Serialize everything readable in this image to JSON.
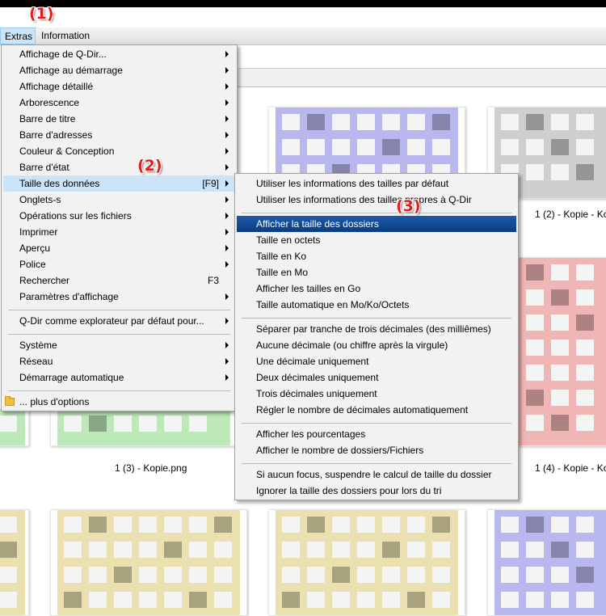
{
  "menubar": {
    "items": [
      {
        "label": "Extras"
      },
      {
        "label": "Information"
      }
    ]
  },
  "callouts": [
    "(1)",
    "(2)",
    "(3)"
  ],
  "main_menu": {
    "items": [
      {
        "label": "Affichage de Q-Dir...",
        "submenu": true
      },
      {
        "label": "Affichage au démarrage",
        "submenu": true
      },
      {
        "label": "Affichage détaillé",
        "submenu": true
      },
      {
        "label": "Arborescence",
        "submenu": true
      },
      {
        "label": "Barre de titre",
        "submenu": true
      },
      {
        "label": "Barre d'adresses",
        "submenu": true
      },
      {
        "label": "Couleur & Conception",
        "submenu": true
      },
      {
        "label": "Barre d'état",
        "submenu": true
      },
      {
        "label": "Taille des données",
        "shortcut": "[F9]",
        "submenu": true,
        "highlighted": true
      },
      {
        "label": "Onglets-s",
        "submenu": true
      },
      {
        "label": "Opérations sur les fichiers",
        "submenu": true
      },
      {
        "label": "Imprimer",
        "submenu": true
      },
      {
        "label": "Aperçu",
        "submenu": true
      },
      {
        "label": "Police",
        "submenu": true
      },
      {
        "label": "Rechercher",
        "shortcut": "F3"
      },
      {
        "label": "Paramètres d'affichage",
        "submenu": true
      },
      {
        "label": "Q-Dir comme explorateur par défaut pour...",
        "submenu": true
      },
      {
        "label": "Système",
        "submenu": true
      },
      {
        "label": "Réseau",
        "submenu": true
      },
      {
        "label": "Démarrage automatique",
        "submenu": true
      },
      {
        "label": "... plus d'options",
        "icon": "folder-icon"
      }
    ]
  },
  "sub_menu": {
    "items": [
      {
        "label": "Utiliser les informations des tailles par défaut"
      },
      {
        "label": "Utiliser les informations des tailles propres à Q-Dir"
      },
      {
        "label": "Afficher la taille des dossiers",
        "highlighted": true
      },
      {
        "label": "Taille en octets"
      },
      {
        "label": "Taille en Ko"
      },
      {
        "label": "Taille en Mo"
      },
      {
        "label": "Afficher les tailles en Go"
      },
      {
        "label": "Taille automatique en Mo/Ko/Octets"
      },
      {
        "label": "Séparer par tranche de trois décimales (des milliêmes)"
      },
      {
        "label": "Aucune décimale (ou chiffre après la virgule)"
      },
      {
        "label": "Une décimale uniquement"
      },
      {
        "label": "Deux décimales uniquement"
      },
      {
        "label": "Trois décimales uniquement"
      },
      {
        "label": "Régler le nombre de décimales automatiquement"
      },
      {
        "label": "Afficher les pourcentages"
      },
      {
        "label": "Afficher le nombre de dossiers/Fichiers"
      },
      {
        "label": "Si aucun focus, suspendre le calcul de taille du dossier"
      },
      {
        "label": "Ignorer la taille des dossiers pour lors du tri"
      }
    ]
  },
  "files": {
    "captions": [
      "1 (2) - Kopie - Ko",
      "1 (3) - Kopie.png",
      "1 (4) - Kopie - Ko"
    ]
  },
  "colors": {
    "accent": "#0a3d80",
    "menu_highlight": "#cce4f7",
    "callout": "#e01e1e",
    "thumb_blue": "#b9b8ee",
    "thumb_gray": "#cfcfcf",
    "thumb_red": "#f0b5b5",
    "thumb_green": "#bde8b8",
    "thumb_yellow": "#ebe1b0"
  }
}
